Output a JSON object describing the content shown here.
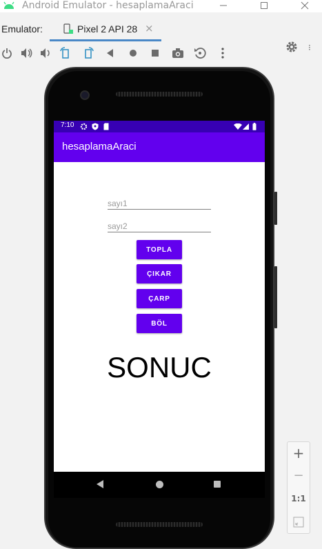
{
  "window": {
    "title": "Android Emulator - hesaplamaAraci"
  },
  "tabrow": {
    "label": "Emulator:",
    "device_tab": "Pixel 2 API 28"
  },
  "colors": {
    "primary": "#6200ee",
    "primary_dark": "#3700b3",
    "tab_underline": "#4a88c7"
  },
  "toolbar": {
    "icons": [
      "power-icon",
      "volume-up-icon",
      "volume-down-icon",
      "rotate-left-icon",
      "rotate-right-icon",
      "back-icon",
      "home-icon",
      "overview-icon",
      "camera-icon",
      "replay-icon",
      "more-icon"
    ]
  },
  "device": {
    "status_time": "7:10",
    "app_title": "hesaplamaAraci",
    "input1_placeholder": "sayı1",
    "input2_placeholder": "sayı2",
    "buttons": {
      "add": "TOPLA",
      "subtract": "ÇIKAR",
      "multiply": "ÇARP",
      "divide": "BÖL"
    },
    "result": "SONUC"
  },
  "zoom": {
    "plus": "+",
    "minus": "−",
    "one_to_one": "1:1"
  }
}
